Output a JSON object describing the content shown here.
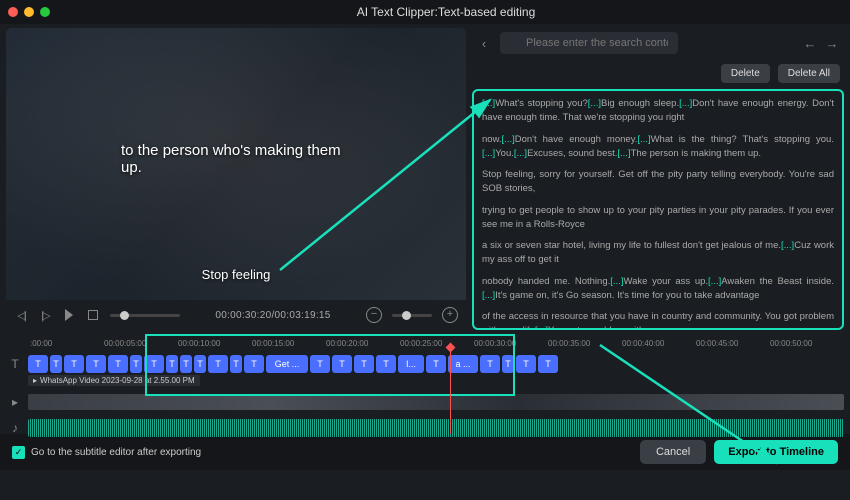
{
  "window": {
    "title": "AI Text Clipper:Text-based editing"
  },
  "video": {
    "caption_main": "to the person who's making them up.",
    "caption_lower": "Stop feeling"
  },
  "playback": {
    "timecode": "00:00:30:20/00:03:19:15"
  },
  "search": {
    "placeholder": "Please enter the search content"
  },
  "buttons": {
    "delete": "Delete",
    "delete_all": "Delete All",
    "cancel": "Cancel",
    "export": "Export to Timeline"
  },
  "transcript": {
    "lines": [
      "[...]What's stopping you?[...]Big enough sleep.[...]Don't have enough energy. Don't have enough time. That we're stopping you right",
      " now.[...]Don't have enough money.[...]What is the thing? That's stopping you.[...]You.[...]Excuses, sound best.[...]The person is making them up.",
      " Stop feeling, sorry for yourself. Get off the pity party telling everybody. You're sad  SOB stories,",
      " trying to get people to show up to your pity parties in your pity parades. If you ever see me in a Rolls-Royce",
      " a six or seven star hotel, living my life to  fullest don't get jealous of me.[...]Cuz  work my ass off to get it",
      " nobody handed me. Nothing.[...]Wake your ass up.[...]Awaken the Beast inside.[...]It's game on, it's Go season. It's time for you to take advantage",
      " of the access in  resource that you have in  country and  community. You got  problem with your life[...]You got a problem with your"
    ]
  },
  "timeline": {
    "ticks": [
      ":00:00",
      "00:00:05:00",
      "00:00:10:00",
      "00:00:15:00",
      "00:00:20:00",
      "00:00:25:00",
      "00:00:30:00",
      "00:00:35:00",
      "00:00:40:00",
      "00:00:45:00",
      "00:00:50:00"
    ],
    "text_clips": [
      "T",
      "T",
      "T",
      "T",
      "T",
      "T",
      "T",
      "T",
      "T",
      "T",
      "T",
      "T",
      "T",
      "Get ...",
      "T",
      "T",
      "T",
      "T",
      "I...",
      "T",
      "a ...",
      "T",
      "T",
      "T",
      "T"
    ],
    "media_name": "WhatsApp Video 2023-09-28 at 2.55.00 PM"
  },
  "footer": {
    "checkbox_label": "Go to the subtitle editor after exporting"
  },
  "colors": {
    "accent": "#18e0bb",
    "clip": "#4a6eff"
  }
}
